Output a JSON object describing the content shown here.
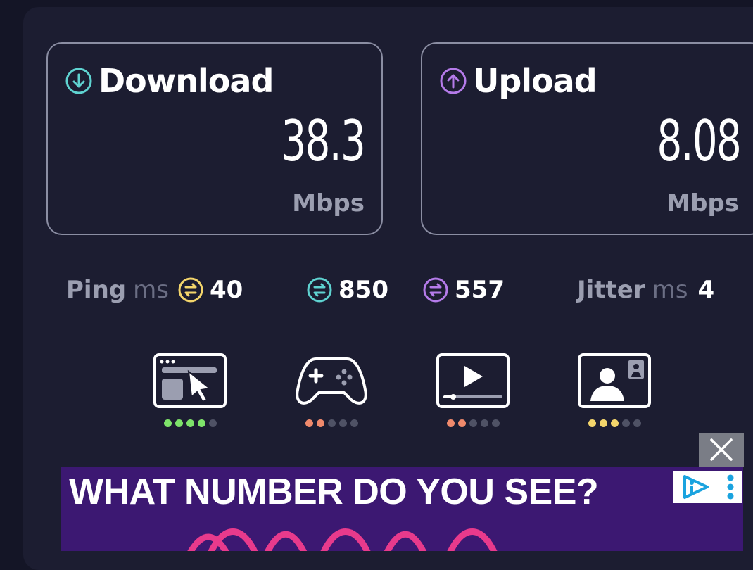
{
  "download": {
    "label": "Download",
    "value": "38.3",
    "unit": "Mbps",
    "icon": "arrow-down-circle-icon",
    "accent": "#5fd3d1"
  },
  "upload": {
    "label": "Upload",
    "value": "8.08",
    "unit": "Mbps",
    "icon": "arrow-up-circle-icon",
    "accent": "#b57bea"
  },
  "ping": {
    "label": "Ping",
    "unit": "ms",
    "idle": {
      "value": "40",
      "color": "#f3d56b"
    },
    "download": {
      "value": "850",
      "color": "#5fd3d1"
    },
    "upload": {
      "value": "557",
      "color": "#b57bea"
    }
  },
  "jitter": {
    "label": "Jitter",
    "unit": "ms",
    "value": "4"
  },
  "activities": [
    {
      "icon": "web-browsing-icon",
      "rating": 4,
      "of": 5,
      "color": "#7ee36a"
    },
    {
      "icon": "gaming-controller-icon",
      "rating": 2,
      "of": 5,
      "color": "#f08a6c"
    },
    {
      "icon": "video-streaming-icon",
      "rating": 2,
      "of": 5,
      "color": "#f08a6c"
    },
    {
      "icon": "video-call-icon",
      "rating": 3,
      "of": 5,
      "color": "#f3d56b"
    }
  ],
  "ad": {
    "title": "WHAT NUMBER DO YOU SEE?",
    "close_icon": "close-icon",
    "info_icon": "adchoices-icon",
    "menu_icon": "more-vertical-icon"
  }
}
